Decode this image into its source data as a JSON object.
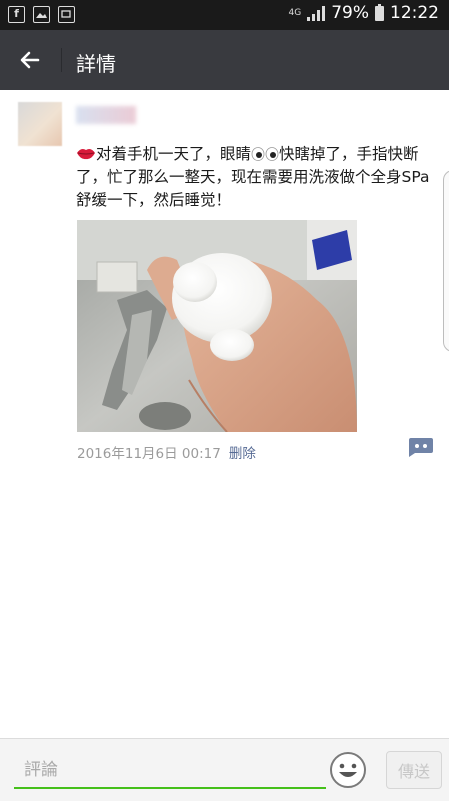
{
  "status_bar": {
    "icons": [
      "facebook-icon",
      "image-icon",
      "gallery-icon"
    ],
    "network": "4G",
    "battery": "79%",
    "time": "12:22"
  },
  "header": {
    "title": "詳情"
  },
  "post": {
    "text_part1": "对着手机一天了，眼睛",
    "text_part2": "快瞎掉了，手指快断了，忙了那么一整天，现在需要用洗液做个全身SPa舒缓一下，然后睡觉！",
    "timestamp": "2016年11月6日 00:17",
    "delete_label": "删除"
  },
  "comment_bar": {
    "placeholder": "評論",
    "send_label": "傳送"
  },
  "colors": {
    "header_bg": "#393a3f",
    "accent_green": "#45c01a",
    "link_blue": "#576b95"
  }
}
